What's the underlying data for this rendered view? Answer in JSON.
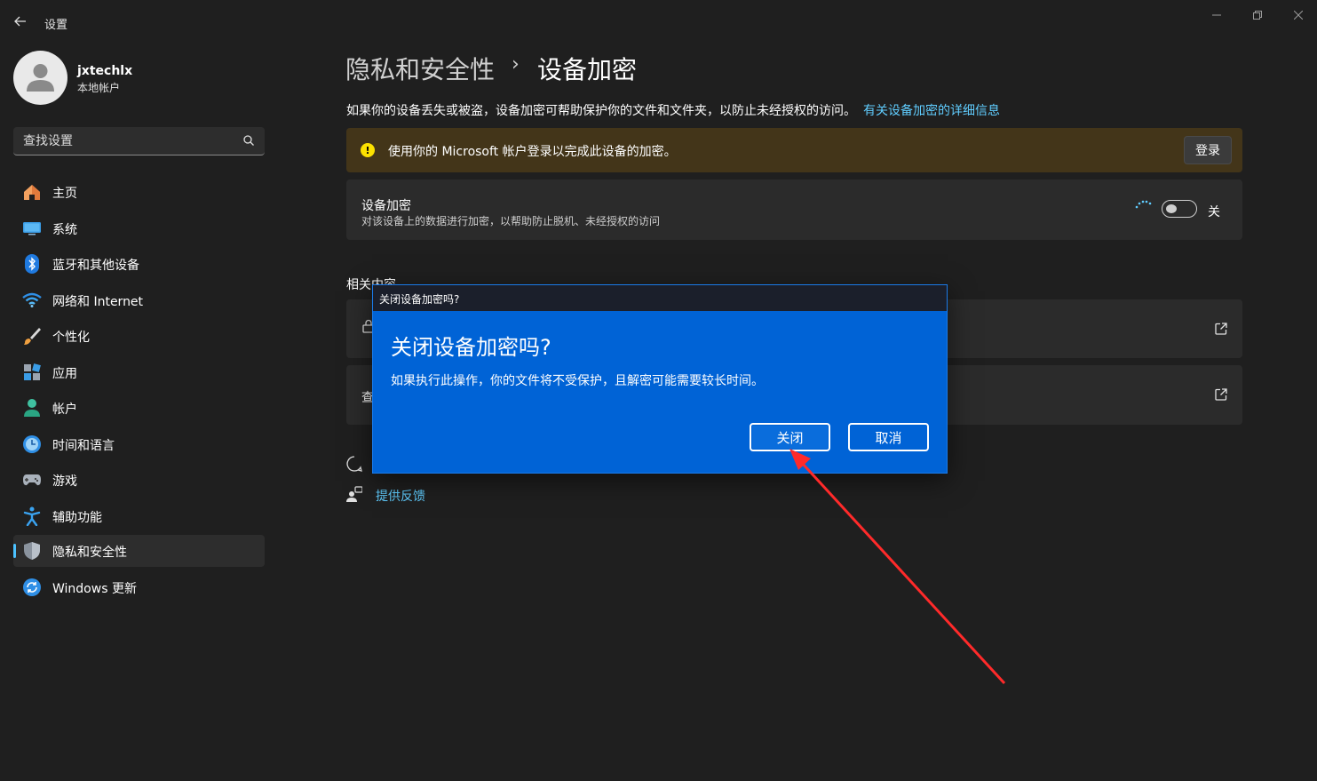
{
  "window": {
    "app_title": "设置"
  },
  "profile": {
    "name": "jxtechlx",
    "account_type": "本地帐户"
  },
  "search": {
    "placeholder": "查找设置"
  },
  "nav": {
    "items": [
      {
        "label": "主页",
        "icon": "home-icon"
      },
      {
        "label": "系统",
        "icon": "system-icon"
      },
      {
        "label": "蓝牙和其他设备",
        "icon": "bluetooth-icon"
      },
      {
        "label": "网络和 Internet",
        "icon": "wifi-icon"
      },
      {
        "label": "个性化",
        "icon": "brush-icon"
      },
      {
        "label": "应用",
        "icon": "apps-icon"
      },
      {
        "label": "帐户",
        "icon": "account-icon"
      },
      {
        "label": "时间和语言",
        "icon": "time-language-icon"
      },
      {
        "label": "游戏",
        "icon": "gamepad-icon"
      },
      {
        "label": "辅助功能",
        "icon": "accessibility-icon"
      },
      {
        "label": "隐私和安全性",
        "icon": "shield-icon",
        "active": true
      },
      {
        "label": "Windows 更新",
        "icon": "update-icon"
      }
    ]
  },
  "breadcrumb": {
    "parent": "隐私和安全性",
    "separator": "›",
    "current": "设备加密"
  },
  "description": {
    "text": "如果你的设备丢失或被盗，设备加密可帮助保护你的文件和文件夹，以防止未经授权的访问。",
    "link": "有关设备加密的详细信息"
  },
  "warning": {
    "icon_glyph": "!",
    "text": "使用你的 Microsoft 帐户登录以完成此设备的加密。",
    "button": "登录"
  },
  "encryption_card": {
    "title": "设备加密",
    "subtitle": "对该设备上的数据进行加密，以帮助防止脱机、未经授权的访问",
    "toggle_state": "关"
  },
  "related": {
    "label": "相关内容",
    "row2_text": "查"
  },
  "feedback": {
    "label": "提供反馈"
  },
  "dialog": {
    "titlebar": "关闭设备加密吗?",
    "heading": "关闭设备加密吗?",
    "body": "如果执行此操作，你的文件将不受保护，且解密可能需要较长时间。",
    "confirm": "关闭",
    "cancel": "取消"
  },
  "colors": {
    "background": "#1f1f1f",
    "card": "#2b2b2b",
    "accent": "#60cdff",
    "warning_bg": "#433519",
    "dialog_bg": "#0063d6",
    "annotation_arrow": "#ff2a2a"
  }
}
